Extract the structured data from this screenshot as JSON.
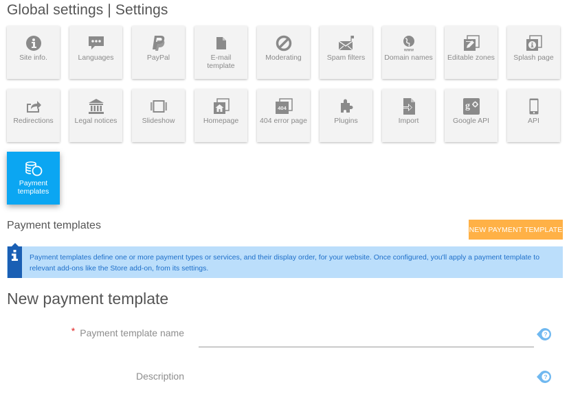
{
  "header": {
    "title": "Global settings | Settings"
  },
  "tiles": [
    {
      "label": "Site info.",
      "icon": "info-circle-icon"
    },
    {
      "label": "Languages",
      "icon": "chat-bubble-icon"
    },
    {
      "label": "PayPal",
      "icon": "paypal-icon"
    },
    {
      "label": "E-mail template",
      "icon": "document-icon"
    },
    {
      "label": "Moderating",
      "icon": "block-icon"
    },
    {
      "label": "Spam filters",
      "icon": "mail-flag-icon"
    },
    {
      "label": "Domain names",
      "icon": "globe-www-icon"
    },
    {
      "label": "Editable zones",
      "icon": "edit-stack-icon"
    },
    {
      "label": "Splash page",
      "icon": "info-stack-icon"
    },
    {
      "label": "Redirections",
      "icon": "share-arrow-icon"
    },
    {
      "label": "Legal notices",
      "icon": "bank-icon"
    },
    {
      "label": "Slideshow",
      "icon": "slideshow-icon"
    },
    {
      "label": "Homepage",
      "icon": "home-stack-icon"
    },
    {
      "label": "404 error page",
      "icon": "error-404-icon"
    },
    {
      "label": "Plugins",
      "icon": "puzzle-icon"
    },
    {
      "label": "Import",
      "icon": "import-file-icon"
    },
    {
      "label": "Google API",
      "icon": "google-plus-icon"
    },
    {
      "label": "API",
      "icon": "mobile-phone-icon"
    },
    {
      "label": "Payment templates",
      "icon": "coins-icon",
      "active": true
    }
  ],
  "section": {
    "title": "Payment templates",
    "new_button_label": "NEW PAYMENT TEMPLATE",
    "info_text": "Payment templates define one or more payment types or services, and their display order, for your website. Once configured, you'll apply a payment template to relevant add-ons like the Store add-on, from its settings."
  },
  "form": {
    "title": "New payment template",
    "fields": [
      {
        "label": "Payment template name",
        "required": true,
        "value": "",
        "placeholder": ""
      },
      {
        "label": "Description",
        "required": false,
        "value": "",
        "placeholder": ""
      }
    ]
  },
  "colors": {
    "accent_active_tile": "#0ba6f2",
    "button_orange": "#ffb146",
    "info_background": "#bbdefb",
    "info_side": "#1a5fb4",
    "info_text": "#1e6fc9",
    "help_icon": "#6fb8f0",
    "required_star": "#e02020"
  }
}
